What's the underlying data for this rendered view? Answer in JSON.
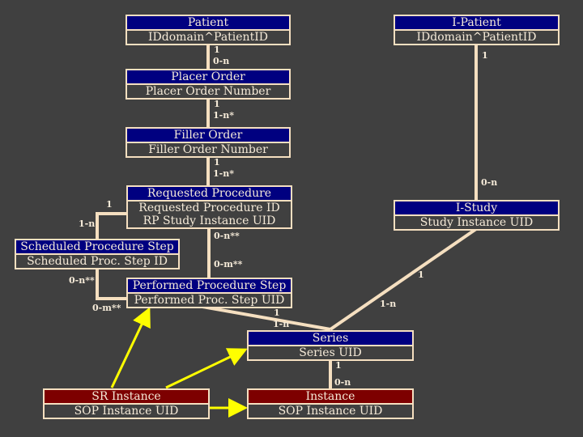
{
  "boxes": {
    "patient": {
      "title": "Patient",
      "fields": [
        "IDdomain^PatientID"
      ]
    },
    "ipatient": {
      "title": "I-Patient",
      "fields": [
        "IDdomain^PatientID"
      ]
    },
    "placer": {
      "title": "Placer Order",
      "fields": [
        "Placer Order Number"
      ]
    },
    "filler": {
      "title": "Filler Order",
      "fields": [
        "Filler Order Number"
      ]
    },
    "requested": {
      "title": "Requested Procedure",
      "fields": [
        "Requested Procedure ID",
        "RP Study Instance UID"
      ]
    },
    "istudy": {
      "title": "I-Study",
      "fields": [
        "Study Instance UID"
      ]
    },
    "sps": {
      "title": "Scheduled Procedure Step",
      "fields": [
        "Scheduled Proc. Step ID"
      ]
    },
    "pps": {
      "title": "Performed Procedure Step",
      "fields": [
        "Performed Proc. Step UID"
      ]
    },
    "series": {
      "title": "Series",
      "fields": [
        "Series UID"
      ]
    },
    "sr": {
      "title": "SR Instance",
      "fields": [
        "SOP Instance UID"
      ]
    },
    "instance": {
      "title": "Instance",
      "fields": [
        "SOP Instance UID"
      ]
    }
  },
  "cardinality": {
    "patient_placer": [
      "1",
      "0-n"
    ],
    "ipatient_istudy": [
      "1",
      "0-n"
    ],
    "placer_filler": [
      "1",
      "1-n*"
    ],
    "filler_requested": [
      "1",
      "1-n*"
    ],
    "requested_pps": [
      "0-n**",
      "0-m**"
    ],
    "requested_sps": [
      "1",
      "1-n"
    ],
    "sps_pps": [
      "0-n**",
      "0-m**"
    ],
    "istudy_series": [
      "1",
      "1-n"
    ],
    "pps_series": [
      "1",
      "1-n"
    ],
    "series_instance": [
      "1",
      "0-n"
    ]
  },
  "colors": {
    "entity": "#000080",
    "instance": "#7d0000",
    "line": "#f5dfc0",
    "reference": "#ffff00",
    "background": "#404040"
  }
}
